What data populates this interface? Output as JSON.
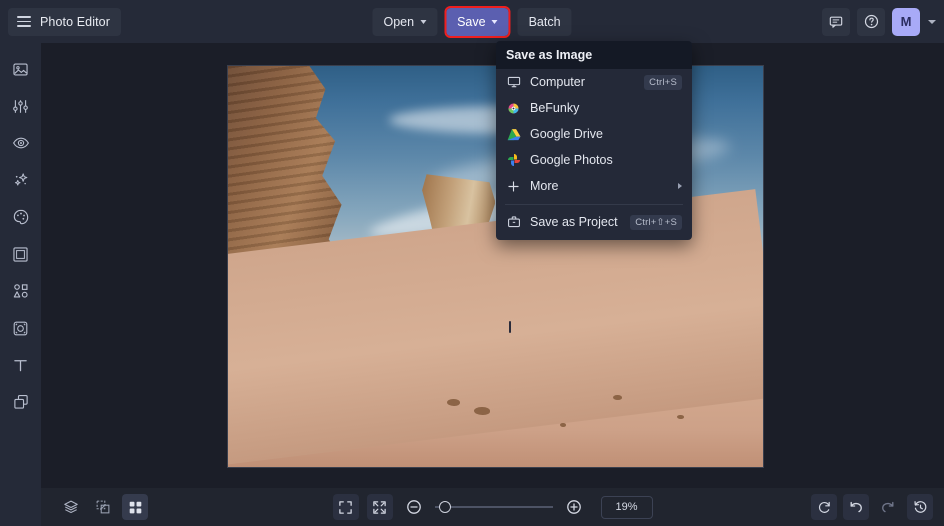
{
  "header": {
    "menu_icon": "hamburger-icon",
    "brand_label": "Photo Editor",
    "open_label": "Open",
    "save_label": "Save",
    "batch_label": "Batch",
    "feedback_icon": "chat-icon",
    "help_icon": "help-icon",
    "avatar_initial": "M",
    "account_chevron_icon": "chevron-down-icon",
    "save_highlight_color": "#f01f1f",
    "save_bg_color": "#5b5fb0",
    "avatar_bg_color": "#a8aaf7"
  },
  "sidebar": {
    "items": [
      {
        "icon": "image-icon",
        "name": "image"
      },
      {
        "icon": "sliders-icon",
        "name": "edit"
      },
      {
        "icon": "eye-icon",
        "name": "touch-up"
      },
      {
        "icon": "sparkles-icon",
        "name": "effects"
      },
      {
        "icon": "palette-icon",
        "name": "artsy"
      },
      {
        "icon": "frame-icon",
        "name": "frames"
      },
      {
        "icon": "shapes-icon",
        "name": "graphics"
      },
      {
        "icon": "overlay-icon",
        "name": "textures"
      },
      {
        "icon": "text-icon",
        "name": "text"
      },
      {
        "icon": "layers-stack-icon",
        "name": "collage"
      }
    ]
  },
  "save_menu": {
    "title": "Save as Image",
    "items": [
      {
        "label": "Computer",
        "icon": "monitor-icon",
        "shortcut": "Ctrl+S",
        "has_submenu": false
      },
      {
        "label": "BeFunky",
        "icon": "befunky-icon",
        "shortcut": "",
        "has_submenu": false
      },
      {
        "label": "Google Drive",
        "icon": "google-drive-icon",
        "shortcut": "",
        "has_submenu": false
      },
      {
        "label": "Google Photos",
        "icon": "google-photos-icon",
        "shortcut": "",
        "has_submenu": false
      },
      {
        "label": "More",
        "icon": "plus-icon",
        "shortcut": "",
        "has_submenu": true
      }
    ],
    "project": {
      "label": "Save as Project",
      "icon": "project-icon",
      "shortcut": "Ctrl+⇧+S"
    }
  },
  "bottom_bar": {
    "left_tools": [
      {
        "icon": "layers-icon",
        "name": "layers",
        "active": false
      },
      {
        "icon": "compare-icon",
        "name": "compare",
        "active": false
      },
      {
        "icon": "grid-icon",
        "name": "grid",
        "active": true
      }
    ],
    "view_tools": [
      {
        "icon": "fullscreen-icon",
        "name": "fullscreen"
      },
      {
        "icon": "fit-screen-icon",
        "name": "fit-to-screen"
      }
    ],
    "zoom_out_icon": "minus-circle-icon",
    "zoom_in_icon": "plus-circle-icon",
    "zoom_value": "19%",
    "zoom_slider_percent": 4,
    "right_tools": [
      {
        "icon": "reset-icon",
        "name": "reset",
        "disabled": false
      },
      {
        "icon": "undo-icon",
        "name": "undo",
        "disabled": false
      },
      {
        "icon": "redo-icon",
        "name": "redo",
        "disabled": true
      },
      {
        "icon": "history-icon",
        "name": "history",
        "disabled": false
      }
    ]
  },
  "canvas": {
    "photo_alt": "desert landscape with sandstone rock formations, sand dune and a lone hiker",
    "background_color": "#1b1e28"
  }
}
